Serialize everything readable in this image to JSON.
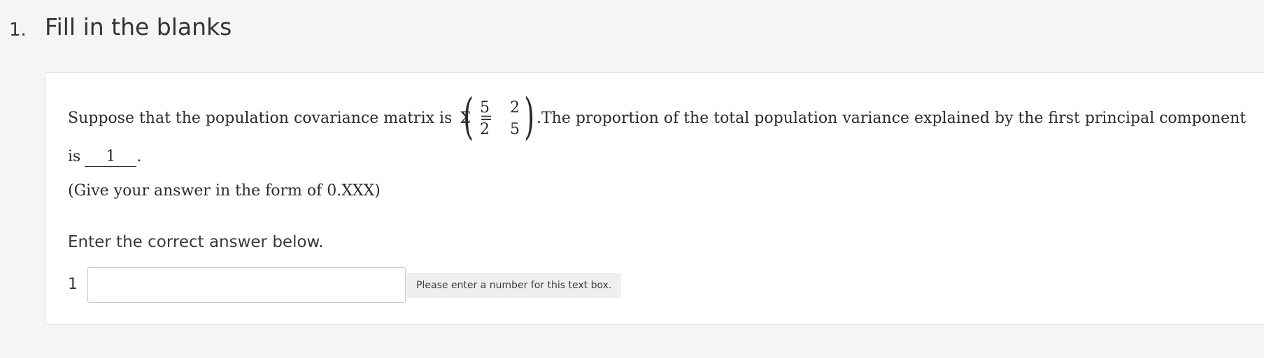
{
  "question": {
    "number": "1.",
    "title": "Fill in the blanks"
  },
  "body": {
    "intro": "Suppose that the population covariance matrix is",
    "sigma": "Σ",
    "equals": "=",
    "matrix": [
      [
        "5",
        "2"
      ],
      [
        "2",
        "5"
      ]
    ],
    "after_matrix": ".The proportion of the total population variance explained by the first principal component",
    "line2_prefix": "is",
    "blank_label": "1",
    "line2_suffix": ".",
    "hint": "(Give your answer in the form of 0.XXX)"
  },
  "answer": {
    "prompt": "Enter the correct answer below.",
    "label": "1",
    "value": "",
    "placeholder": "",
    "message": "Please enter a number for this text box."
  }
}
